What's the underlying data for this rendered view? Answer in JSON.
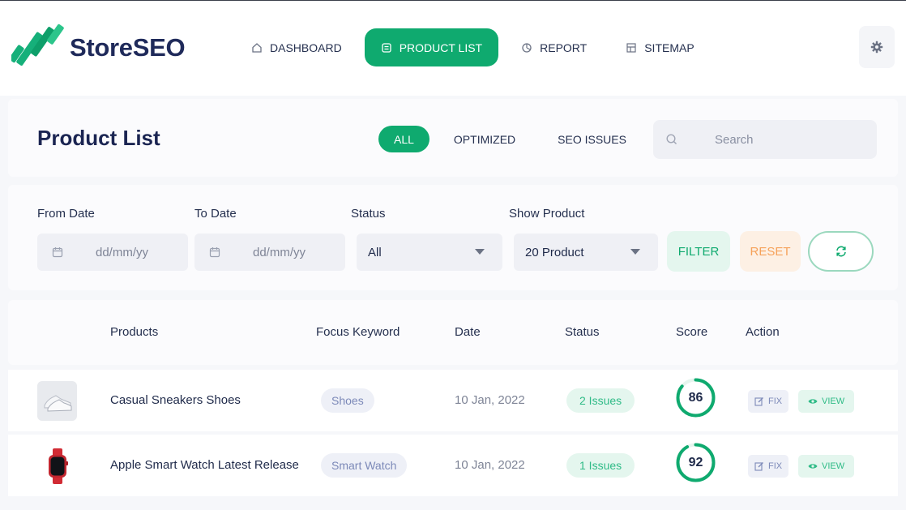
{
  "app": {
    "logo_text": "StoreSEO"
  },
  "nav": {
    "items": [
      {
        "label": "DASHBOARD",
        "icon": "home-icon"
      },
      {
        "label": "PRODUCT LIST",
        "icon": "list-icon",
        "active": true
      },
      {
        "label": "REPORT",
        "icon": "pie-chart-icon"
      },
      {
        "label": "SITEMAP",
        "icon": "sitemap-icon"
      }
    ],
    "settings_icon": "gear-icon"
  },
  "page": {
    "title": "Product List",
    "tabs": [
      {
        "label": "ALL",
        "active": true
      },
      {
        "label": "OPTIMIZED"
      },
      {
        "label": "SEO ISSUES"
      }
    ],
    "search": {
      "placeholder": "Search",
      "value": ""
    }
  },
  "filters": {
    "from_date": {
      "label": "From Date",
      "placeholder": "dd/mm/yy"
    },
    "to_date": {
      "label": "To Date",
      "placeholder": "dd/mm/yy"
    },
    "status": {
      "label": "Status",
      "value": "All"
    },
    "show_product": {
      "label": "Show Product",
      "value": "20 Product"
    },
    "filter_label": "FILTER",
    "reset_label": "RESET",
    "refresh_icon": "refresh-icon"
  },
  "table": {
    "headers": {
      "products": "Products",
      "keyword": "Focus Keyword",
      "date": "Date",
      "status": "Status",
      "score": "Score",
      "action": "Action"
    },
    "rows": [
      {
        "product": "Casual Sneakers Shoes",
        "thumb": "sneakers-image",
        "keyword": "Shoes",
        "date": "10 Jan, 2022",
        "status": "2 Issues",
        "score": "86",
        "score_fraction": 0.86,
        "fix_label": "FIX",
        "view_label": "VIEW"
      },
      {
        "product": "Apple Smart Watch Latest Release",
        "thumb": "smartwatch-image",
        "keyword": "Smart Watch",
        "date": "10 Jan, 2022",
        "status": "1 Issues",
        "score": "92",
        "score_fraction": 0.92,
        "fix_label": "FIX",
        "view_label": "VIEW"
      }
    ]
  },
  "colors": {
    "brand_green": "#0faa6f",
    "navy": "#1b2552",
    "reset_orange": "#f6a25a"
  }
}
